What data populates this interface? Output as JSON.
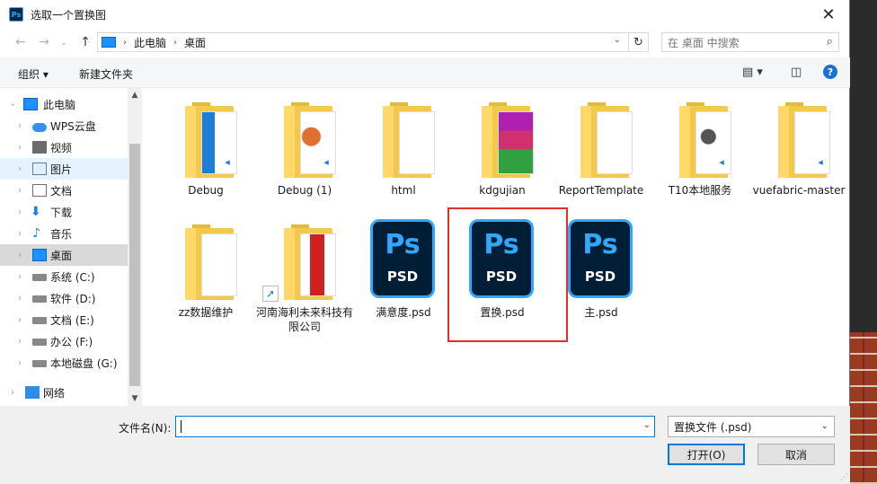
{
  "window": {
    "title": "选取一个置换图",
    "app_icon": "Ps",
    "close_glyph": "✕"
  },
  "nav": {
    "back_glyph": "←",
    "forward_glyph": "→",
    "dropdown_glyph": "⌄",
    "up_glyph": "↑"
  },
  "address": {
    "crumbs": [
      "此电脑",
      "桌面"
    ],
    "separator": "›",
    "refresh_glyph": "↻",
    "dropdown_glyph": "⌄"
  },
  "search": {
    "placeholder": "在 桌面 中搜索",
    "icon": "search-icon",
    "glyph": "⌕"
  },
  "toolbar": {
    "organize_label": "组织 ▾",
    "new_folder_label": "新建文件夹",
    "view_glyph": "▤ ▾",
    "pane_glyph": "◫",
    "help_glyph": "?"
  },
  "sidebar": {
    "items": [
      {
        "label": "此电脑",
        "icon": "pc-icon",
        "state": "normal"
      },
      {
        "label": "WPS云盘",
        "icon": "cloud-icon",
        "state": "normal"
      },
      {
        "label": "视频",
        "icon": "video-icon",
        "state": "normal"
      },
      {
        "label": "图片",
        "icon": "picture-icon",
        "state": "hover"
      },
      {
        "label": "文档",
        "icon": "document-icon",
        "state": "normal"
      },
      {
        "label": "下载",
        "icon": "download-icon",
        "state": "normal"
      },
      {
        "label": "音乐",
        "icon": "music-icon",
        "state": "normal"
      },
      {
        "label": "桌面",
        "icon": "desktop-icon",
        "state": "selected"
      },
      {
        "label": "系统 (C:)",
        "icon": "drive-icon",
        "state": "normal"
      },
      {
        "label": "软件 (D:)",
        "icon": "drive-icon",
        "state": "normal"
      },
      {
        "label": "文档 (E:)",
        "icon": "drive-icon",
        "state": "normal"
      },
      {
        "label": "办公 (F:)",
        "icon": "drive-icon",
        "state": "normal"
      },
      {
        "label": "本地磁盘 (G:)",
        "icon": "drive-icon",
        "state": "normal"
      },
      {
        "label": "网络",
        "icon": "network-icon",
        "state": "normal"
      }
    ],
    "expand_glyph": "›",
    "scroll_up": "▲",
    "scroll_down": "▼"
  },
  "files": [
    {
      "label": "Debug",
      "type": "folder"
    },
    {
      "label": "Debug (1)",
      "type": "folder"
    },
    {
      "label": "html",
      "type": "folder"
    },
    {
      "label": "kdgujian",
      "type": "folder"
    },
    {
      "label": "ReportTemplate",
      "type": "folder"
    },
    {
      "label": "T10本地服务",
      "type": "folder"
    },
    {
      "label": "vuefabric-master",
      "type": "folder"
    },
    {
      "label": "zz数据维护",
      "type": "folder"
    },
    {
      "label": "河南海利未来科技有限公司",
      "type": "shortcut"
    },
    {
      "label": "满意度.psd",
      "type": "psd"
    },
    {
      "label": "置换.psd",
      "type": "psd",
      "highlighted": true
    },
    {
      "label": "主.psd",
      "type": "psd"
    }
  ],
  "psd_icon": {
    "top": "Ps",
    "bottom": "PSD"
  },
  "folder_badge": "◂",
  "shortcut_glyph": "➚",
  "bottom": {
    "filename_label": "文件名(N):",
    "filename_value": "",
    "filename_dd": "⌄",
    "filetype_value": "置换文件 (.psd)",
    "filetype_dd": "⌄",
    "open_label": "打开(O)",
    "cancel_label": "取消"
  },
  "colors": {
    "accent": "#0078d7",
    "highlight_border": "#e0302d",
    "psd_bg": "#001e36",
    "psd_blue": "#31a8ff",
    "folder": "#f2c94c"
  }
}
